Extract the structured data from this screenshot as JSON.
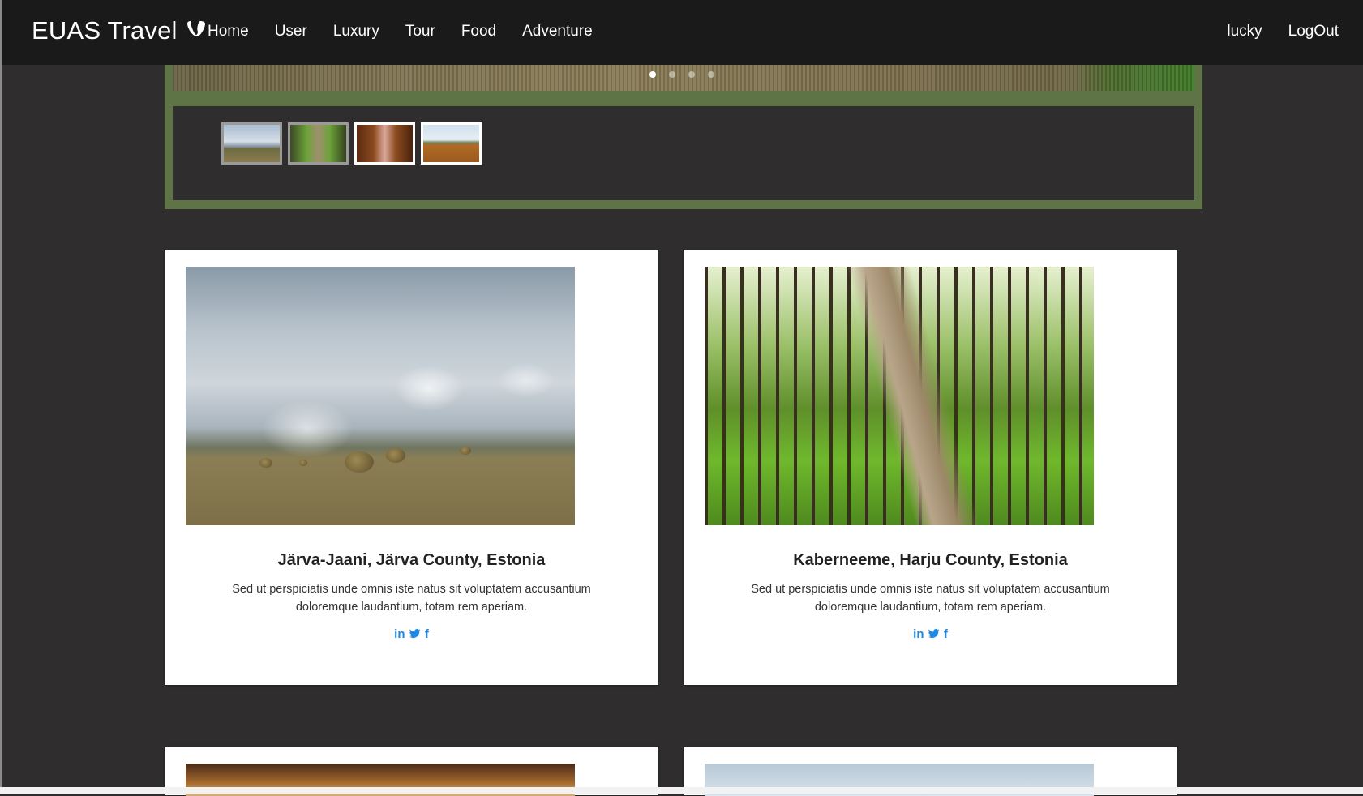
{
  "navbar": {
    "brand": "EUAS Travel",
    "brand_icon": "typo3-logo-icon",
    "links": [
      "Home",
      "User",
      "Luxury",
      "Tour",
      "Food",
      "Adventure"
    ],
    "right_links": [
      "lucky",
      "LogOut"
    ]
  },
  "carousel": {
    "dots": 4,
    "active_dot": 0,
    "thumbnails": [
      "field-thumbnail",
      "forest-path-thumbnail",
      "autumn-house-thumbnail",
      "bog-boardwalk-thumbnail"
    ]
  },
  "cards": [
    {
      "title": "Järva-Jaani, Järva County, Estonia",
      "text": "Sed ut perspiciatis unde omnis iste natus sit voluptatem accusantium doloremque laudantium, totam rem aperiam.",
      "social": {
        "linkedin": "in",
        "twitter": "🐦",
        "facebook": "f"
      }
    },
    {
      "title": "Kaberneeme, Harju County, Estonia",
      "text": "Sed ut perspiciatis unde omnis iste natus sit voluptatem accusantium doloremque laudantium, totam rem aperiam.",
      "social": {
        "linkedin": "in",
        "twitter": "🐦",
        "facebook": "f"
      }
    }
  ],
  "colors": {
    "page_background": "#2f2d2e",
    "navbar": "#1a1a1a",
    "carousel_frame": "#5e7447",
    "social_links": "#1e88e5"
  }
}
